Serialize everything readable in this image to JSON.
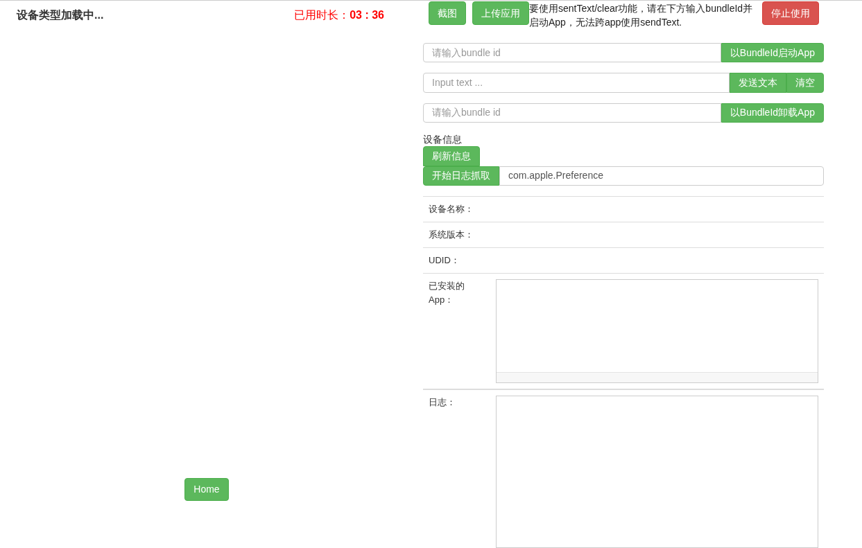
{
  "header": {
    "device_type": "设备类型加载中...",
    "timer_label": "已用时长：",
    "timer_value": "03 : 36"
  },
  "home_button": "Home",
  "toolbar": {
    "screenshot_button": "截图",
    "upload_button": "上传应用",
    "notice": "要使用sentText/clear功能，请在下方输入bundleId并启动App，无法跨app使用sendText.",
    "stop_button": "停止使用"
  },
  "launch": {
    "placeholder": "请输入bundle id",
    "button": "以BundleId启动App"
  },
  "send_text": {
    "placeholder": "Input text ...",
    "send_button": "发送文本",
    "clear_button": "清空"
  },
  "uninstall": {
    "placeholder": "请输入bundle id",
    "button": "以BundleId卸载App"
  },
  "device_info": {
    "title": "设备信息",
    "refresh_button": "刷新信息",
    "log_button": "开始日志抓取",
    "log_filter_value": "com.apple.Preference",
    "rows": [
      {
        "label": "设备名称："
      },
      {
        "label": "系统版本："
      },
      {
        "label": "UDID："
      }
    ],
    "installed_label": "已安装的App：",
    "log_label": "日志："
  }
}
